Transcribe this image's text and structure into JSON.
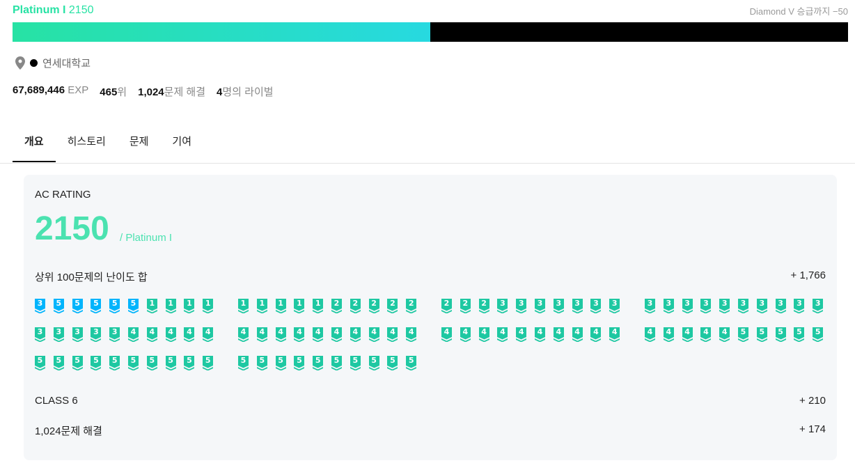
{
  "header": {
    "tier": "Platinum I",
    "rating": "2150",
    "next_tier_text": "Diamond V 승급까지 −50",
    "progress_fraction": 0.5
  },
  "profile": {
    "school": "연세대학교",
    "exp_value": "67,689,446",
    "exp_unit": "EXP",
    "rank_value": "465",
    "rank_unit": "위",
    "solved_value": "1,024",
    "solved_unit": "문제 해결",
    "rival_value": "4",
    "rival_unit": "명의 라이벌"
  },
  "tabs": [
    {
      "label": "개요"
    },
    {
      "label": "히스토리"
    },
    {
      "label": "문제"
    },
    {
      "label": "기여"
    }
  ],
  "ac_rating": {
    "label": "AC RATING",
    "value": "2150",
    "tier_text": "/ Platinum I",
    "top100_label": "상위 100문제의 난이도 합",
    "top100_value": "+ 1,766",
    "class_label": "CLASS 6",
    "class_value": "+ 210",
    "solved_label": "1,024문제 해결",
    "solved_value": "+ 174"
  },
  "colors": {
    "accent": "#27e2a4",
    "accent_light": "#4be2b0",
    "progress_end": "#27d9e0",
    "diamond_badge": "#00b4fc",
    "ruby_badge": "#1ec8a2"
  },
  "problem_badges": [
    [
      "3",
      "5",
      "5",
      "5",
      "5",
      "5",
      "1",
      "1",
      "1",
      "1",
      "1",
      "1",
      "1",
      "1",
      "1",
      "2",
      "2",
      "2",
      "2",
      "2",
      "2",
      "2",
      "2",
      "3",
      "3",
      "3",
      "3",
      "3",
      "3",
      "3",
      "3",
      "3",
      "3",
      "3",
      "3",
      "3",
      "3",
      "3",
      "3",
      "3"
    ],
    [
      "3",
      "3",
      "3",
      "3",
      "3",
      "4",
      "4",
      "4",
      "4",
      "4",
      "4",
      "4",
      "4",
      "4",
      "4",
      "4",
      "4",
      "4",
      "4",
      "4",
      "4",
      "4",
      "4",
      "4",
      "4",
      "4",
      "4",
      "4",
      "4",
      "4",
      "4",
      "4",
      "4",
      "4",
      "4",
      "5",
      "5",
      "5",
      "5",
      "5"
    ],
    [
      "5",
      "5",
      "5",
      "5",
      "5",
      "5",
      "5",
      "5",
      "5",
      "5",
      "5",
      "5",
      "5",
      "5",
      "5",
      "5",
      "5",
      "5",
      "5",
      "5"
    ]
  ],
  "badge_tiers": [
    [
      "diamond",
      "diamond",
      "diamond",
      "diamond",
      "diamond",
      "diamond",
      "ruby",
      "ruby",
      "ruby",
      "ruby",
      "ruby",
      "ruby",
      "ruby",
      "ruby",
      "ruby",
      "ruby",
      "ruby",
      "ruby",
      "ruby",
      "ruby",
      "ruby",
      "ruby",
      "ruby",
      "ruby",
      "ruby",
      "ruby",
      "ruby",
      "ruby",
      "ruby",
      "ruby",
      "ruby",
      "ruby",
      "ruby",
      "ruby",
      "ruby",
      "ruby",
      "ruby",
      "ruby",
      "ruby",
      "ruby"
    ],
    [
      "ruby",
      "ruby",
      "ruby",
      "ruby",
      "ruby",
      "ruby",
      "ruby",
      "ruby",
      "ruby",
      "ruby",
      "ruby",
      "ruby",
      "ruby",
      "ruby",
      "ruby",
      "ruby",
      "ruby",
      "ruby",
      "ruby",
      "ruby",
      "ruby",
      "ruby",
      "ruby",
      "ruby",
      "ruby",
      "ruby",
      "ruby",
      "ruby",
      "ruby",
      "ruby",
      "ruby",
      "ruby",
      "ruby",
      "ruby",
      "ruby",
      "ruby",
      "ruby",
      "ruby",
      "ruby",
      "ruby"
    ],
    [
      "ruby",
      "ruby",
      "ruby",
      "ruby",
      "ruby",
      "ruby",
      "ruby",
      "ruby",
      "ruby",
      "ruby",
      "ruby",
      "ruby",
      "ruby",
      "ruby",
      "ruby",
      "ruby",
      "ruby",
      "ruby",
      "ruby",
      "ruby"
    ]
  ]
}
